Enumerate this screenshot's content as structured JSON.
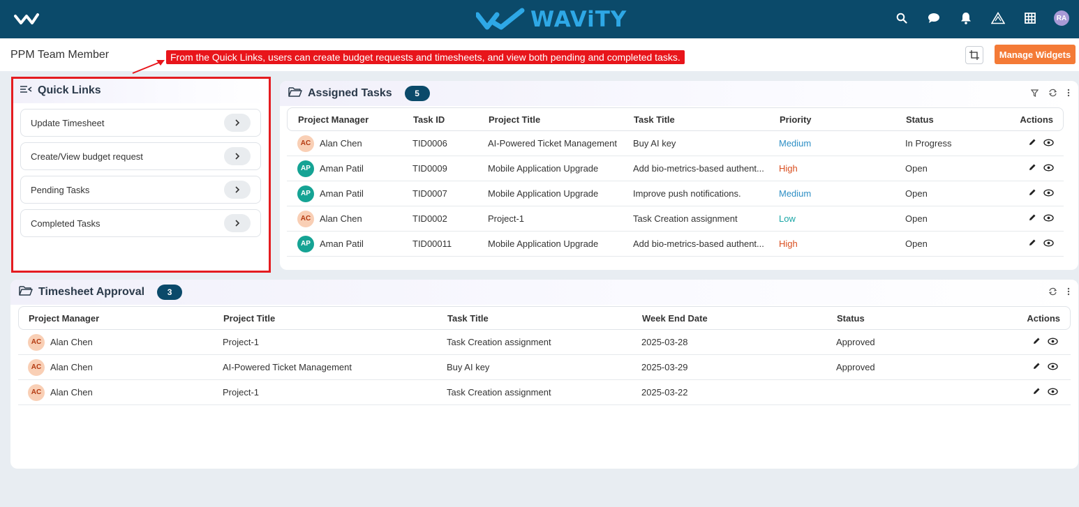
{
  "app": {
    "brand": "WAViTY",
    "user_initials": "RA"
  },
  "subheader": {
    "page_title": "PPM Team Member",
    "annotation": "From the Quick Links, users can create budget requests and timesheets, and view both pending and completed tasks.",
    "manage_widgets_label": "Manage Widgets"
  },
  "quick_links": {
    "title": "Quick Links",
    "items": [
      {
        "label": "Update Timesheet"
      },
      {
        "label": "Create/View budget request"
      },
      {
        "label": "Pending Tasks"
      },
      {
        "label": "Completed Tasks"
      }
    ]
  },
  "assigned_tasks": {
    "title": "Assigned Tasks",
    "count": "5",
    "columns": [
      "Project Manager",
      "Task ID",
      "Project Title",
      "Task Title",
      "Priority",
      "Status",
      "Actions"
    ],
    "rows": [
      {
        "initials": "AC",
        "manager": "Alan Chen",
        "task_id": "TID0006",
        "project": "AI-Powered Ticket Management",
        "task": "Buy AI key",
        "priority": "Medium",
        "status": "In Progress"
      },
      {
        "initials": "AP",
        "manager": "Aman Patil",
        "task_id": "TID0009",
        "project": "Mobile Application Upgrade",
        "task": "Add bio-metrics-based authent...",
        "priority": "High",
        "status": "Open"
      },
      {
        "initials": "AP",
        "manager": "Aman Patil",
        "task_id": "TID0007",
        "project": "Mobile Application Upgrade",
        "task": "Improve push notifications.",
        "priority": "Medium",
        "status": "Open"
      },
      {
        "initials": "AC",
        "manager": "Alan Chen",
        "task_id": "TID0002",
        "project": "Project-1",
        "task": "Task Creation assignment",
        "priority": "Low",
        "status": "Open"
      },
      {
        "initials": "AP",
        "manager": "Aman Patil",
        "task_id": "TID00011",
        "project": "Mobile Application Upgrade",
        "task": "Add bio-metrics-based authent...",
        "priority": "High",
        "status": "Open"
      }
    ]
  },
  "timesheet_approval": {
    "title": "Timesheet Approval",
    "count": "3",
    "columns": [
      "Project Manager",
      "Project Title",
      "Task Title",
      "Week End Date",
      "Status",
      "Actions"
    ],
    "rows": [
      {
        "initials": "AC",
        "manager": "Alan Chen",
        "project": "Project-1",
        "task": "Task Creation assignment",
        "week_end": "2025-03-28",
        "status": "Approved"
      },
      {
        "initials": "AC",
        "manager": "Alan Chen",
        "project": "AI-Powered Ticket Management",
        "task": "Buy AI key",
        "week_end": "2025-03-29",
        "status": "Approved"
      },
      {
        "initials": "AC",
        "manager": "Alan Chen",
        "project": "Project-1",
        "task": "Task Creation assignment",
        "week_end": "2025-03-22",
        "status": ""
      }
    ]
  },
  "colors": {
    "topbar": "#0b4a6a",
    "brand": "#2ea8e6",
    "accent_orange": "#f47a36",
    "annotation_red": "#e8151b"
  }
}
